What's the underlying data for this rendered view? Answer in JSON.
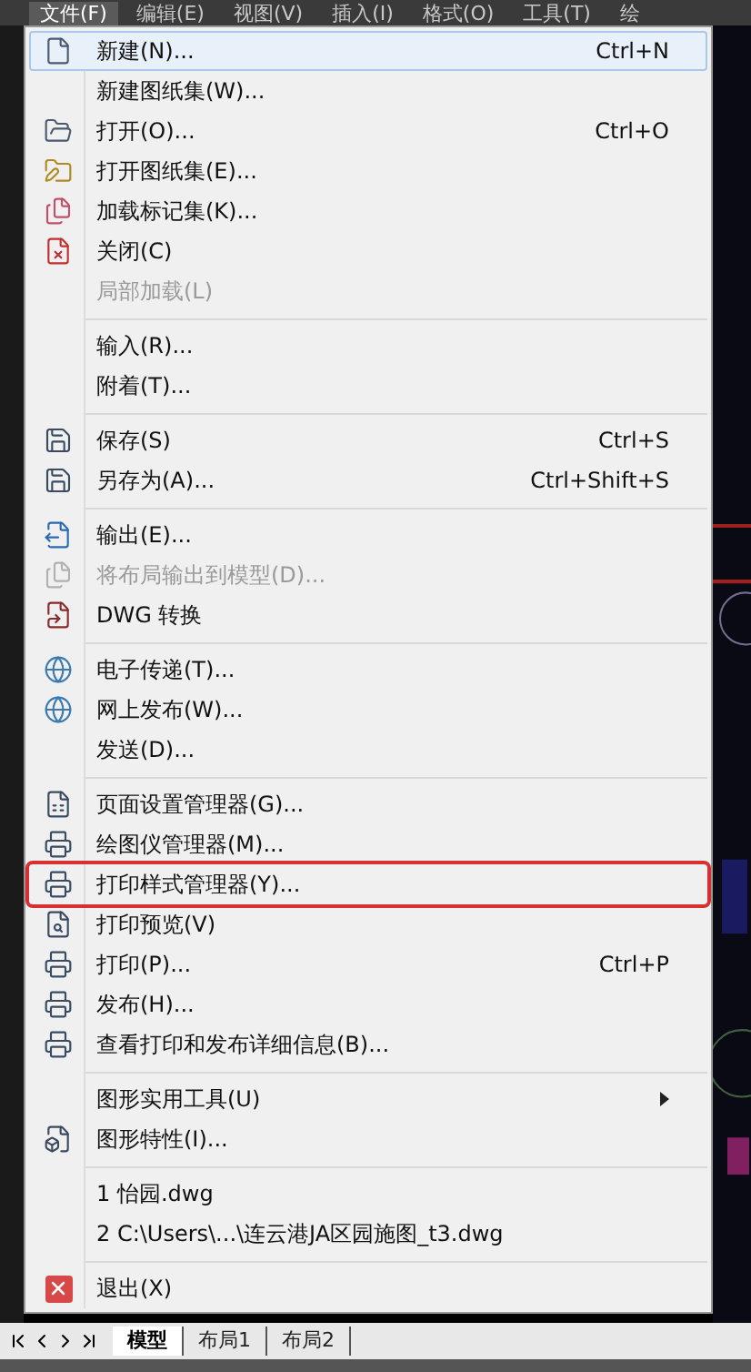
{
  "menubar": [
    {
      "label": "文件(F)",
      "selected": true
    },
    {
      "label": "编辑(E)",
      "selected": false
    },
    {
      "label": "视图(V)",
      "selected": false
    },
    {
      "label": "插入(I)",
      "selected": false
    },
    {
      "label": "格式(O)",
      "selected": false
    },
    {
      "label": "工具(T)",
      "selected": false
    },
    {
      "label": "绘",
      "selected": false
    }
  ],
  "menu": [
    {
      "kind": "item",
      "label": "新建(N)...",
      "shortcut": "Ctrl+N",
      "selected": true,
      "disabled": false,
      "marked": false
    },
    {
      "kind": "item",
      "label": "新建图纸集(W)...",
      "selected": false,
      "disabled": false,
      "marked": false
    },
    {
      "kind": "item",
      "label": "打开(O)...",
      "shortcut": "Ctrl+O",
      "selected": false,
      "disabled": false,
      "marked": false
    },
    {
      "kind": "item",
      "label": "打开图纸集(E)...",
      "selected": false,
      "disabled": false,
      "marked": false
    },
    {
      "kind": "item",
      "label": "加载标记集(K)...",
      "selected": false,
      "disabled": false,
      "marked": false
    },
    {
      "kind": "item",
      "label": "关闭(C)",
      "selected": false,
      "disabled": false,
      "marked": false
    },
    {
      "kind": "item",
      "label": "局部加载(L)",
      "selected": false,
      "disabled": true,
      "marked": false
    },
    {
      "kind": "separator"
    },
    {
      "kind": "item",
      "label": "输入(R)...",
      "selected": false,
      "disabled": false,
      "marked": false
    },
    {
      "kind": "item",
      "label": "附着(T)...",
      "selected": false,
      "disabled": false,
      "marked": false
    },
    {
      "kind": "separator"
    },
    {
      "kind": "item",
      "label": "保存(S)",
      "shortcut": "Ctrl+S",
      "selected": false,
      "disabled": false,
      "marked": false
    },
    {
      "kind": "item",
      "label": "另存为(A)...",
      "shortcut": "Ctrl+Shift+S",
      "selected": false,
      "disabled": false,
      "marked": false
    },
    {
      "kind": "separator"
    },
    {
      "kind": "item",
      "label": "输出(E)...",
      "selected": false,
      "disabled": false,
      "marked": false
    },
    {
      "kind": "item",
      "label": "将布局输出到模型(D)...",
      "selected": false,
      "disabled": true,
      "marked": false
    },
    {
      "kind": "item",
      "label": "DWG 转换",
      "selected": false,
      "disabled": false,
      "marked": false
    },
    {
      "kind": "separator"
    },
    {
      "kind": "item",
      "label": "电子传递(T)...",
      "selected": false,
      "disabled": false,
      "marked": false
    },
    {
      "kind": "item",
      "label": "网上发布(W)...",
      "selected": false,
      "disabled": false,
      "marked": false
    },
    {
      "kind": "item",
      "label": "发送(D)...",
      "selected": false,
      "disabled": false,
      "marked": false
    },
    {
      "kind": "separator"
    },
    {
      "kind": "item",
      "label": "页面设置管理器(G)...",
      "selected": false,
      "disabled": false,
      "marked": false
    },
    {
      "kind": "item",
      "label": "绘图仪管理器(M)...",
      "selected": false,
      "disabled": false,
      "marked": false
    },
    {
      "kind": "item",
      "label": "打印样式管理器(Y)...",
      "selected": false,
      "disabled": false,
      "marked": true
    },
    {
      "kind": "item",
      "label": "打印预览(V)",
      "selected": false,
      "disabled": false,
      "marked": false
    },
    {
      "kind": "item",
      "label": "打印(P)...",
      "shortcut": "Ctrl+P",
      "selected": false,
      "disabled": false,
      "marked": false
    },
    {
      "kind": "item",
      "label": "发布(H)...",
      "selected": false,
      "disabled": false,
      "marked": false
    },
    {
      "kind": "item",
      "label": "查看打印和发布详细信息(B)...",
      "selected": false,
      "disabled": false,
      "marked": false
    },
    {
      "kind": "separator"
    },
    {
      "kind": "item",
      "label": "图形实用工具(U)",
      "submenu": true,
      "selected": false,
      "disabled": false,
      "marked": false
    },
    {
      "kind": "item",
      "label": "图形特性(I)...",
      "selected": false,
      "disabled": false,
      "marked": false
    },
    {
      "kind": "separator"
    },
    {
      "kind": "item",
      "label": "1 怡园.dwg",
      "selected": false,
      "disabled": false,
      "marked": false
    },
    {
      "kind": "item",
      "label": "2 C:\\Users\\...\\连云港JA区园施图_t3.dwg",
      "selected": false,
      "disabled": false,
      "marked": false
    },
    {
      "kind": "separator"
    },
    {
      "kind": "item",
      "label": "退出(X)",
      "selected": false,
      "disabled": false,
      "marked": false
    }
  ],
  "layout_tabs": [
    {
      "label": "模型",
      "selected": true
    },
    {
      "label": "布局1",
      "selected": false
    },
    {
      "label": "布局2",
      "selected": false
    }
  ]
}
